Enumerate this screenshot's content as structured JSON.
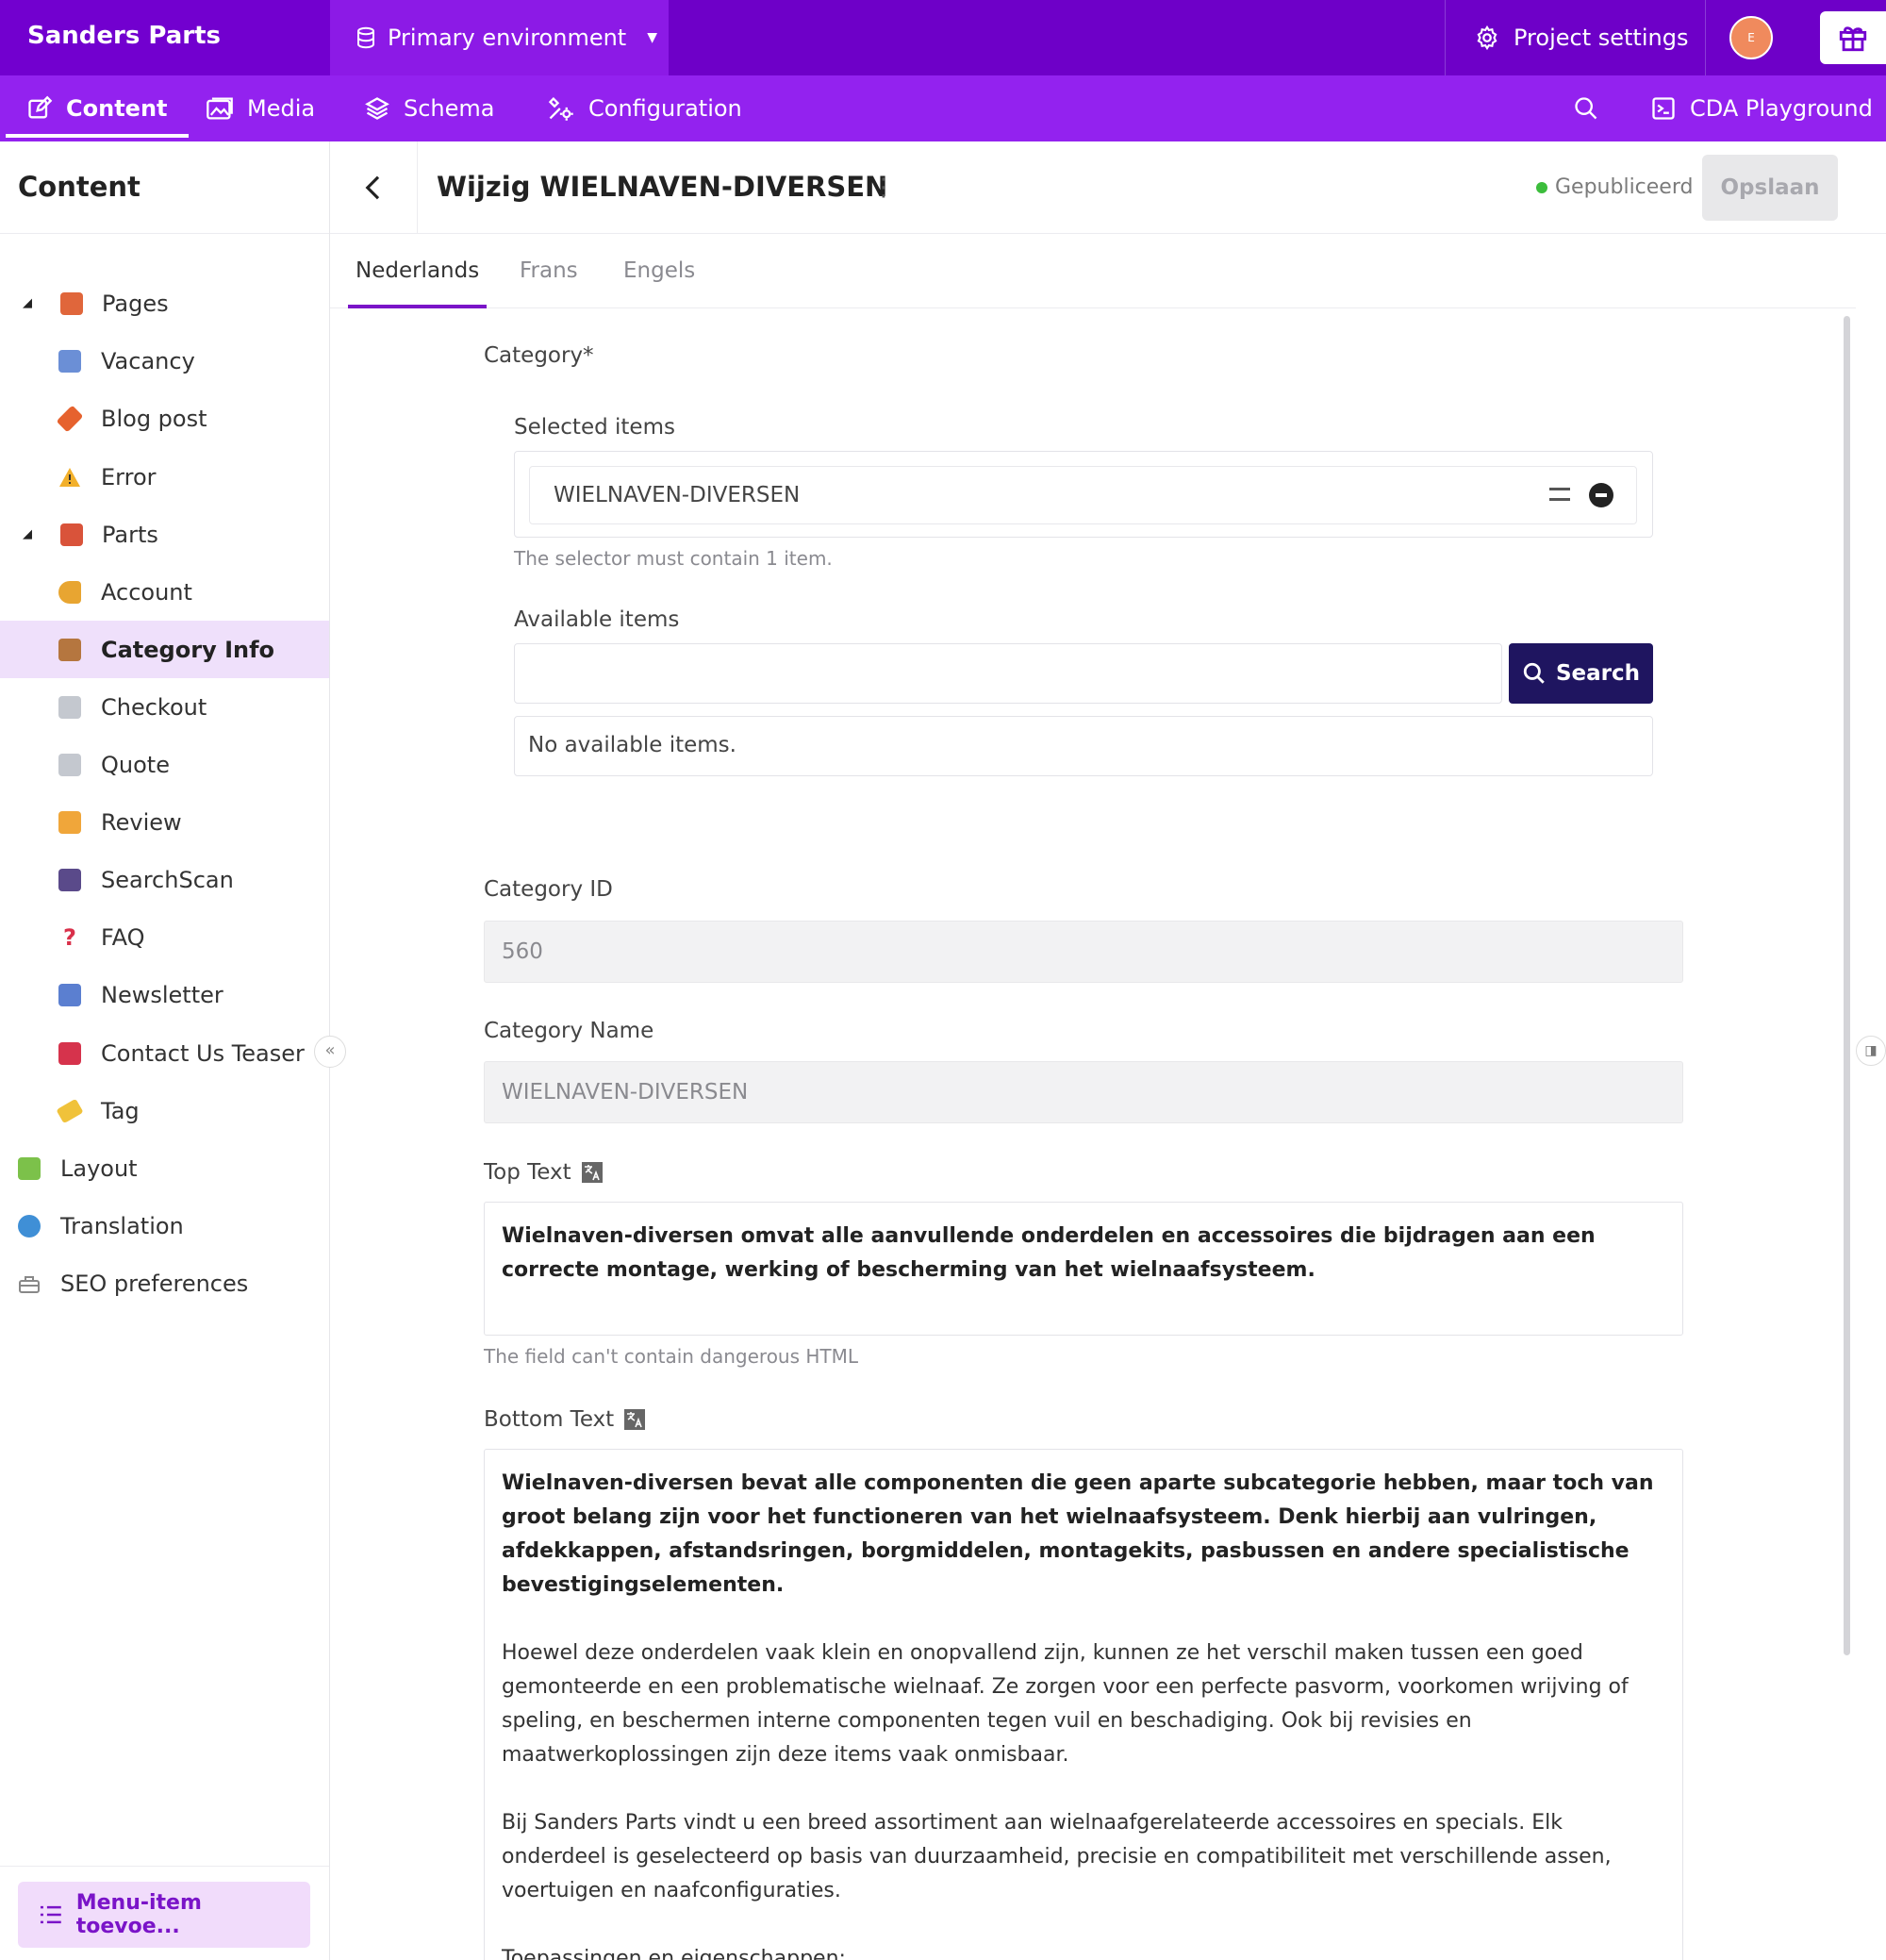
{
  "app": {
    "brand": "Sanders Parts",
    "environment": "Primary environment",
    "project_settings": "Project settings",
    "avatar_initial": "E"
  },
  "nav": {
    "content": "Content",
    "media": "Media",
    "schema": "Schema",
    "configuration": "Configuration",
    "playground": "CDA Playground"
  },
  "sidebar": {
    "title": "Content",
    "items": [
      {
        "label": "Pages",
        "icon": "house-icon",
        "color": "#e0663b"
      },
      {
        "label": "Vacancy",
        "icon": "office-building-icon",
        "color": "#6b8fd6"
      },
      {
        "label": "Blog post",
        "icon": "pencil-icon",
        "color": "#e6622e"
      },
      {
        "label": "Error",
        "icon": "warning-icon",
        "color": "#f2b02b"
      },
      {
        "label": "Parts",
        "icon": "bricks-icon",
        "color": "#d9533a"
      },
      {
        "label": "Account",
        "icon": "key-icon",
        "color": "#e8a531"
      },
      {
        "label": "Category Info",
        "icon": "package-icon",
        "color": "#b5763f"
      },
      {
        "label": "Checkout",
        "icon": "cart-icon",
        "color": "#9aa0a8"
      },
      {
        "label": "Quote",
        "icon": "cart-icon",
        "color": "#9aa0a8"
      },
      {
        "label": "Review",
        "icon": "writing-hand-icon",
        "color": "#f0a63a"
      },
      {
        "label": "SearchScan",
        "icon": "camera-icon",
        "color": "#5a4a8a"
      },
      {
        "label": "FAQ",
        "icon": "question-icon",
        "color": "#d9304a"
      },
      {
        "label": "Newsletter",
        "icon": "mailbox-icon",
        "color": "#5b7fd0"
      },
      {
        "label": "Contact Us Teaser",
        "icon": "telephone-icon",
        "color": "#d6334c"
      },
      {
        "label": "Tag",
        "icon": "label-icon",
        "color": "#f0c23a"
      },
      {
        "label": "Layout",
        "icon": "puzzle-icon",
        "color": "#7cc14a"
      },
      {
        "label": "Translation",
        "icon": "globe-icon",
        "color": "#3f8fd6"
      },
      {
        "label": "SEO preferences",
        "icon": "toolbox-icon",
        "color": "#888888"
      }
    ],
    "add_menu": "Menu-item toevoe..."
  },
  "editor": {
    "title": "Wijzig WIELNAVEN-DIVERSEN",
    "status": "Gepubliceerd",
    "save": "Opslaan",
    "tabs": [
      "Nederlands",
      "Frans",
      "Engels"
    ]
  },
  "form": {
    "category_label": "Category*",
    "selected_items_label": "Selected items",
    "selected_item": "WIELNAVEN-DIVERSEN",
    "selector_hint": "The selector must contain 1 item.",
    "available_items_label": "Available items",
    "search_button": "Search",
    "no_items": "No available items.",
    "category_id_label": "Category ID",
    "category_id_value": "560",
    "category_name_label": "Category Name",
    "category_name_value": "WIELNAVEN-DIVERSEN",
    "top_text_label": "Top Text",
    "top_text": "Wielnaven-diversen omvat alle aanvullende onderdelen en accessoires die bijdragen aan een correcte montage, werking of bescherming van het wielnaafsysteem.",
    "html_hint": "The field can't contain dangerous HTML",
    "bottom_text_label": "Bottom Text",
    "bottom_text_1": "Wielnaven-diversen bevat alle componenten die geen aparte subcategorie hebben, maar toch van groot belang zijn voor het functioneren van het wielnaafsysteem. Denk hierbij aan vulringen, afdekkappen, afstandsringen, borgmiddelen, montagekits, pasbussen en andere specialistische bevestigingselementen.",
    "bottom_text_2": "Hoewel deze onderdelen vaak klein en onopvallend zijn, kunnen ze het verschil maken tussen een goed gemonteerde en een problematische wielnaaf. Ze zorgen voor een perfecte pasvorm, voorkomen wrijving of speling, en beschermen interne componenten tegen vuil en beschadiging. Ook bij revisies en maatwerkoplossingen zijn deze items vaak onmisbaar.",
    "bottom_text_3": "Bij Sanders Parts vindt u een breed assortiment aan wielnaafgerelateerde accessoires en specials. Elk onderdeel is geselecteerd op basis van duurzaamheid, precisie en compatibiliteit met verschillende assen, voertuigen en naafconfiguraties.",
    "bottom_text_4": "Toepassingen en eigenschappen:"
  }
}
